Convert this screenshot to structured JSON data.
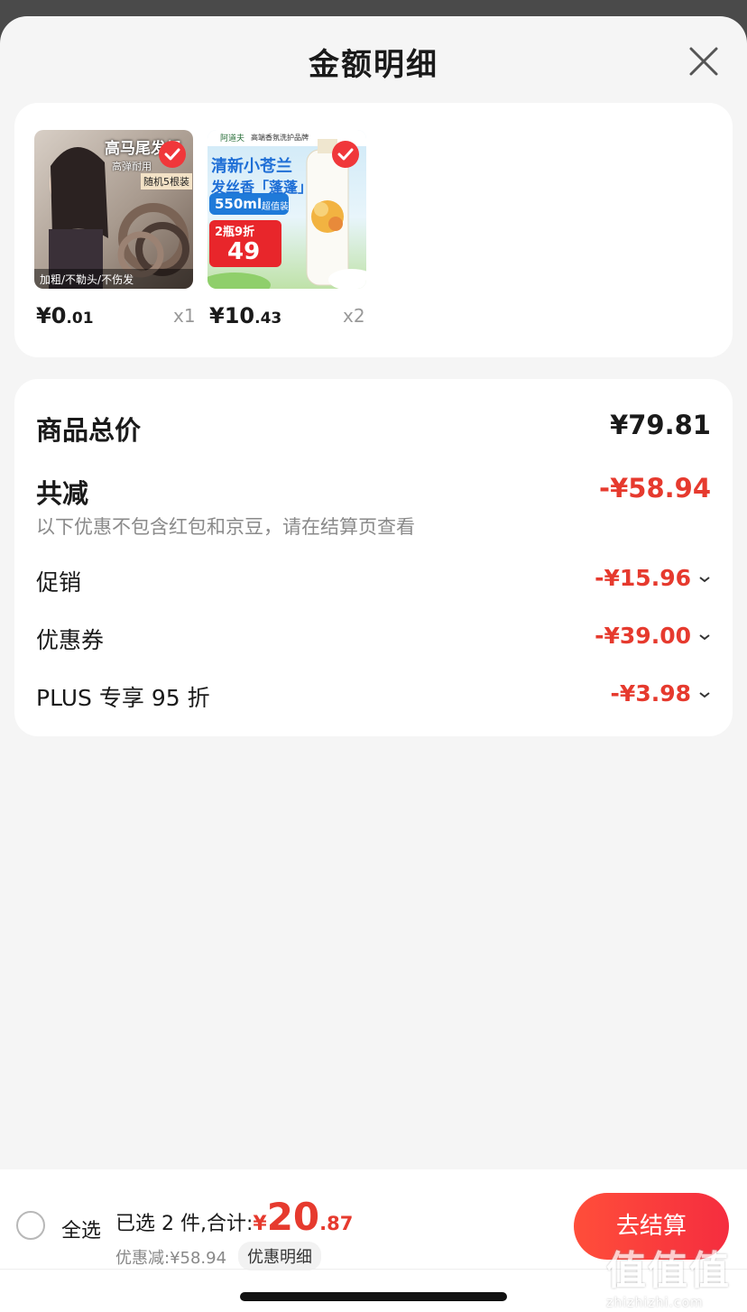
{
  "header": {
    "title": "金额明细"
  },
  "products": [
    {
      "image_text": [
        "高马尾发绳",
        "高弹耐用",
        "随机5根装",
        "加粗/不勒头/不伤发"
      ],
      "price_int": "¥0",
      "price_dec": ".01",
      "qty": "x1",
      "selected": true
    },
    {
      "image_text": [
        "阿道夫",
        "高端香氛洗护品牌",
        "清新小苍兰",
        "发丝香「蓬蓬」",
        "550ml",
        "超值装",
        "2瓶9折",
        "49"
      ],
      "price_int": "¥10",
      "price_dec": ".43",
      "qty": "x2",
      "selected": true
    }
  ],
  "breakdown": {
    "total_label": "商品总价",
    "total_value": "¥79.81",
    "reduce_label": "共减",
    "reduce_value": "-¥58.94",
    "note": "以下优惠不包含红包和京豆，请在结算页查看",
    "items": [
      {
        "label": "促销",
        "value": "-¥15.96"
      },
      {
        "label": "优惠券",
        "value": "-¥39.00"
      },
      {
        "label": "PLUS 专享 95 折",
        "value": "-¥3.98"
      }
    ]
  },
  "bottom_bar": {
    "select_all": "全选",
    "selected_text": "已选 2 件,合计:",
    "currency": "¥",
    "amount_int": "20",
    "amount_dec": ".87",
    "discount_text": "优惠减:¥58.94",
    "detail_tag": "优惠明细",
    "checkout": "去结算"
  },
  "watermark": {
    "chars": "值值值",
    "url": "zhizhizhi.com"
  },
  "colors": {
    "accent_red": "#e63a2e",
    "checkout_gradient_start": "#ff4e3a",
    "checkout_gradient_end": "#f52d3f",
    "background": "#f5f5f5"
  }
}
